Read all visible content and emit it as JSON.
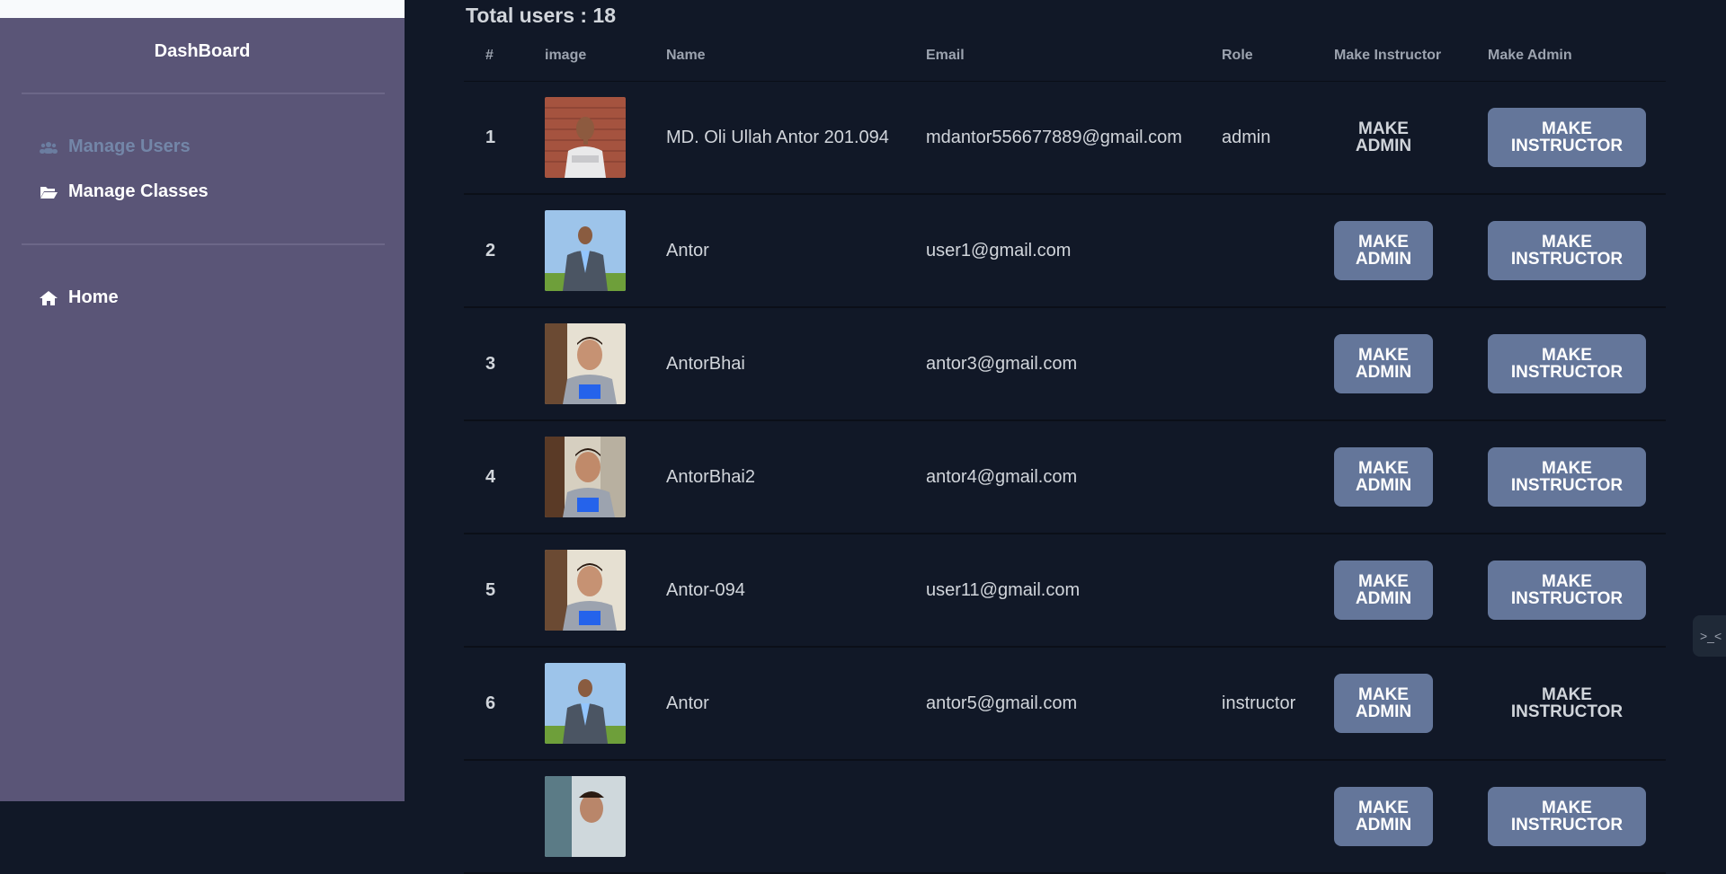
{
  "sidebar": {
    "title": "DashBoard",
    "items": [
      {
        "label": "Manage Users",
        "icon": "users-icon",
        "active": true
      },
      {
        "label": "Manage Classes",
        "icon": "folder-open-icon",
        "active": false
      }
    ],
    "home_label": "Home"
  },
  "main": {
    "total_label": "Total users : 18"
  },
  "table": {
    "headers": [
      "#",
      "image",
      "Name",
      "Email",
      "Role",
      "Make Instructor",
      "Make Admin"
    ],
    "rows": [
      {
        "num": "1",
        "name": "MD. Oli Ullah Antor 201.094",
        "email": "mdantor556677889@gmail.com",
        "role": "admin",
        "btn1": "MAKE ADMIN",
        "btn2": "MAKE INSTRUCTOR"
      },
      {
        "num": "2",
        "name": "Antor",
        "email": "user1@gmail.com",
        "role": "",
        "btn1": "MAKE ADMIN",
        "btn2": "MAKE INSTRUCTOR"
      },
      {
        "num": "3",
        "name": "AntorBhai",
        "email": "antor3@gmail.com",
        "role": "",
        "btn1": "MAKE ADMIN",
        "btn2": "MAKE INSTRUCTOR"
      },
      {
        "num": "4",
        "name": "AntorBhai2",
        "email": "antor4@gmail.com",
        "role": "",
        "btn1": "MAKE ADMIN",
        "btn2": "MAKE INSTRUCTOR"
      },
      {
        "num": "5",
        "name": "Antor-094",
        "email": "user11@gmail.com",
        "role": "",
        "btn1": "MAKE ADMIN",
        "btn2": "MAKE INSTRUCTOR"
      },
      {
        "num": "6",
        "name": "Antor",
        "email": "antor5@gmail.com",
        "role": "instructor",
        "btn1": "MAKE ADMIN",
        "btn2": "MAKE INSTRUCTOR"
      },
      {
        "num": "",
        "name": "",
        "email": "",
        "role": "",
        "btn1": "MAKE ADMIN",
        "btn2": "MAKE INSTRUCTOR"
      }
    ]
  },
  "widget": {
    "text": ">_<"
  }
}
